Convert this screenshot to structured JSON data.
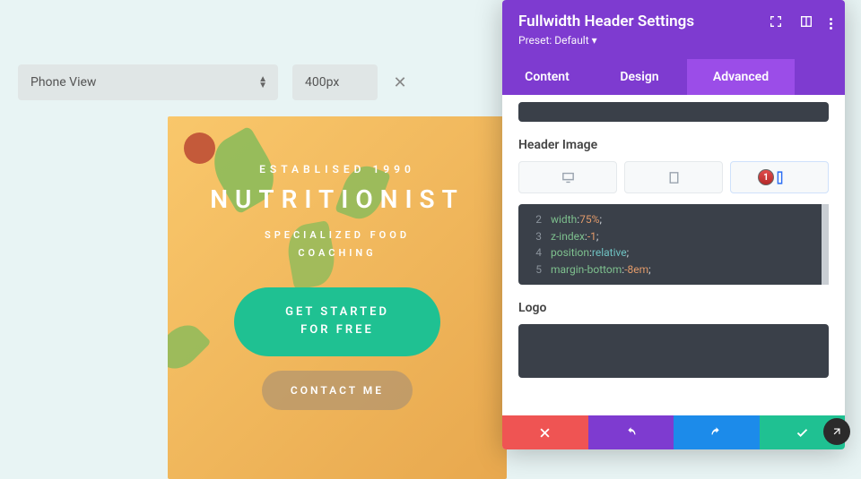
{
  "controls": {
    "view_label": "Phone View",
    "width_value": "400px"
  },
  "preview": {
    "tagline": "ESTABLISED 1990",
    "brand": "NUTRITIONIST",
    "subtitle_line1": "SPECIALIZED FOOD",
    "subtitle_line2": "COACHING",
    "cta_primary": "GET STARTED FOR FREE",
    "cta_secondary": "CONTACT ME"
  },
  "panel": {
    "title": "Fullwidth Header Settings",
    "preset": "Preset: Default ▾",
    "tabs": [
      "Content",
      "Design",
      "Advanced"
    ],
    "section_header_image": "Header Image",
    "badge": "1",
    "code": [
      {
        "n": "2",
        "prop": "width",
        "val": "75%"
      },
      {
        "n": "3",
        "prop": "z-index",
        "val": "-1"
      },
      {
        "n": "4",
        "prop": "position",
        "val": "relative"
      },
      {
        "n": "5",
        "prop": "margin-bottom",
        "val": "-8em"
      }
    ],
    "section_logo": "Logo"
  }
}
